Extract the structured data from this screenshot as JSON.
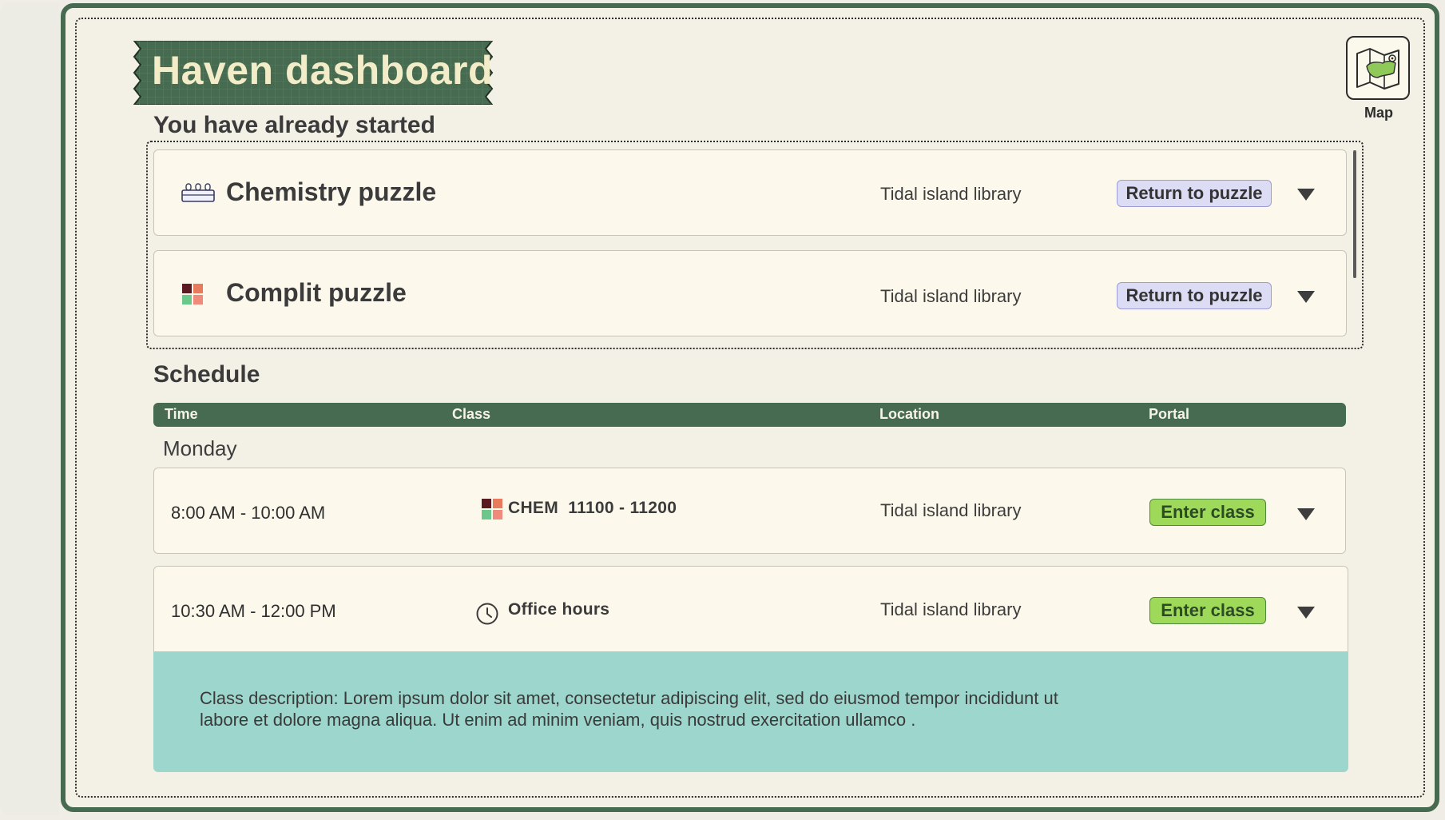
{
  "app": {
    "title": "Haven dashboard"
  },
  "map": {
    "label": "Map",
    "icon": "map-icon"
  },
  "started": {
    "heading": "You have already started",
    "items": [
      {
        "title": "Chemistry puzzle",
        "icon": "lab-equipment-icon",
        "location": "Tidal island library",
        "action": "Return to puzzle"
      },
      {
        "title": "Complit puzzle",
        "icon": "color-blocks-icon",
        "location": "Tidal island library",
        "action": "Return to puzzle"
      }
    ]
  },
  "schedule": {
    "heading": "Schedule",
    "columns": [
      "Time",
      "Class",
      "Location",
      "Portal"
    ],
    "day": "Monday",
    "rows": [
      {
        "time": "8:00 AM - 10:00 AM",
        "class": "CHEM  11100 - 11200",
        "icon": "color-blocks-icon",
        "location": "Tidal island library",
        "action": "Enter class"
      },
      {
        "time": "10:30 AM - 12:00 PM",
        "class": "Office hours",
        "icon": "clock-icon",
        "location": "Tidal island library",
        "action": "Enter class"
      }
    ],
    "expanded_description": "Class description: Lorem ipsum dolor sit amet, consectetur adipiscing elit, sed do eiusmod tempor incididunt ut labore et dolore magna aliqua. Ut enim ad minim veniam, quis nostrud exercitation ullamco ."
  },
  "colors": {
    "frame_green": "#476b50",
    "title_text": "#f2ecc8",
    "return_button": "#dcdcf4",
    "enter_button": "#9ed95a",
    "description_panel": "#9cd6cc",
    "card_background": "#fcf9ec"
  }
}
